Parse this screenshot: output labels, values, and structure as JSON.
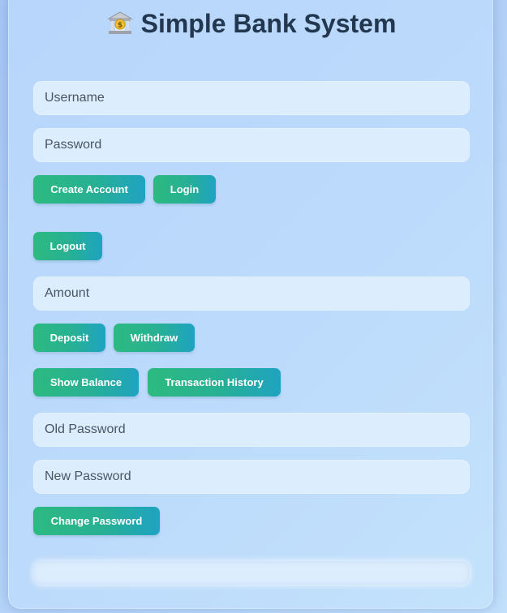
{
  "app": {
    "title": "Simple Bank System",
    "icon": "bank-icon"
  },
  "auth": {
    "username_placeholder": "Username",
    "password_placeholder": "Password",
    "create_account_label": "Create Account",
    "login_label": "Login",
    "logout_label": "Logout"
  },
  "transactions": {
    "amount_placeholder": "Amount",
    "deposit_label": "Deposit",
    "withdraw_label": "Withdraw",
    "show_balance_label": "Show Balance",
    "history_label": "Transaction History"
  },
  "change_password": {
    "old_password_placeholder": "Old Password",
    "new_password_placeholder": "New Password",
    "change_label": "Change Password"
  },
  "output": {
    "text": ""
  },
  "colors": {
    "button_gradient_start": "#2dba80",
    "button_gradient_end": "#1fa3c2",
    "title_color": "#23384f",
    "input_background": "#dcedfd"
  }
}
